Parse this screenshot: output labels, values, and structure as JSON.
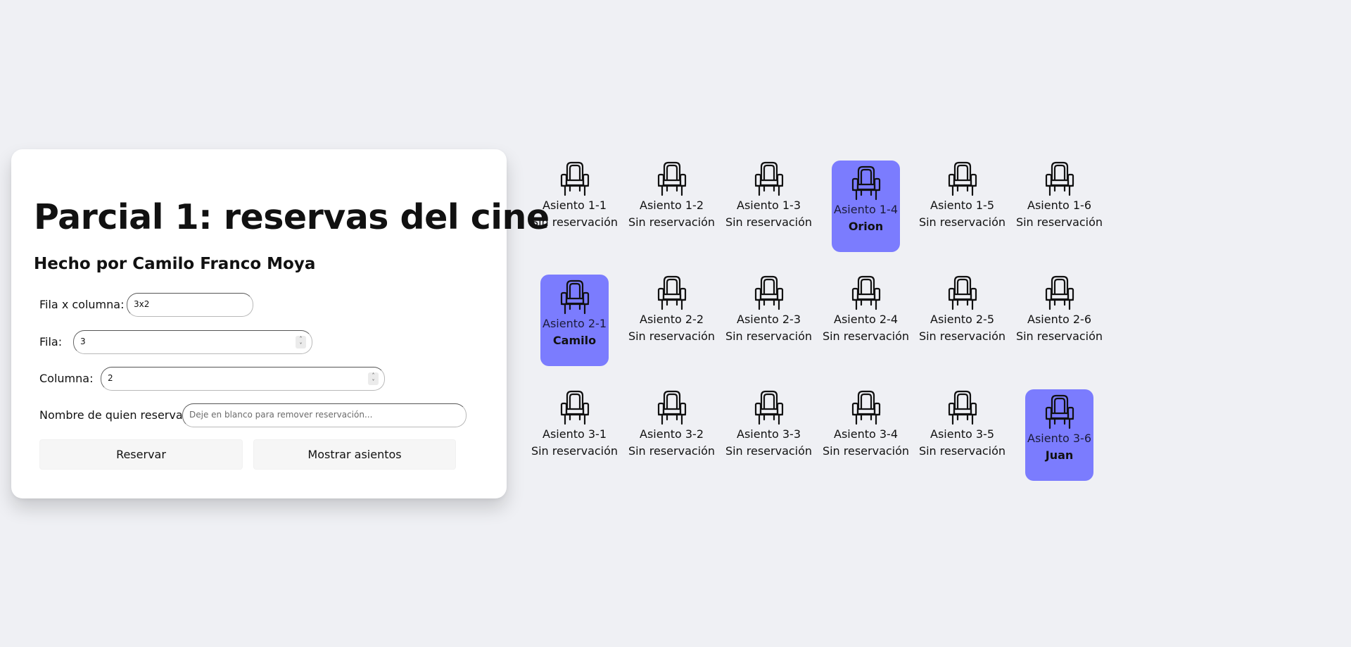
{
  "form": {
    "title": "Parcial 1: reservas del cine",
    "subtitle": "Hecho por Camilo Franco Moya",
    "fila_columna_label": "Fila x columna:",
    "fila_columna_value": "3x2",
    "fila_label": "Fila:",
    "fila_value": "3",
    "columna_label": "Columna:",
    "columna_value": "2",
    "nombre_label": "Nombre de quien reserva:",
    "nombre_placeholder": "Deje en blanco para remover reservación...",
    "reservar_button": "Reservar",
    "mostrar_button": "Mostrar asientos"
  },
  "seats": [
    [
      {
        "label": "Asiento 1-1",
        "status": "Sin reservación",
        "reserved": false
      },
      {
        "label": "Asiento 1-2",
        "status": "Sin reservación",
        "reserved": false
      },
      {
        "label": "Asiento 1-3",
        "status": "Sin reservación",
        "reserved": false
      },
      {
        "label": "Asiento 1-4",
        "status": "Orion",
        "reserved": true
      },
      {
        "label": "Asiento 1-5",
        "status": "Sin reservación",
        "reserved": false
      },
      {
        "label": "Asiento 1-6",
        "status": "Sin reservación",
        "reserved": false
      }
    ],
    [
      {
        "label": "Asiento 2-1",
        "status": "Camilo",
        "reserved": true
      },
      {
        "label": "Asiento 2-2",
        "status": "Sin reservación",
        "reserved": false
      },
      {
        "label": "Asiento 2-3",
        "status": "Sin reservación",
        "reserved": false
      },
      {
        "label": "Asiento 2-4",
        "status": "Sin reservación",
        "reserved": false
      },
      {
        "label": "Asiento 2-5",
        "status": "Sin reservación",
        "reserved": false
      },
      {
        "label": "Asiento 2-6",
        "status": "Sin reservación",
        "reserved": false
      }
    ],
    [
      {
        "label": "Asiento 3-1",
        "status": "Sin reservación",
        "reserved": false
      },
      {
        "label": "Asiento 3-2",
        "status": "Sin reservación",
        "reserved": false
      },
      {
        "label": "Asiento 3-3",
        "status": "Sin reservación",
        "reserved": false
      },
      {
        "label": "Asiento 3-4",
        "status": "Sin reservación",
        "reserved": false
      },
      {
        "label": "Asiento 3-5",
        "status": "Sin reservación",
        "reserved": false
      },
      {
        "label": "Asiento 3-6",
        "status": "Juan",
        "reserved": true
      }
    ]
  ],
  "colors": {
    "background": "#eff0f4",
    "reserved_seat": "#7b7cfe",
    "card": "#ffffff"
  },
  "icons": {
    "seat": "cinema-chair-icon",
    "spinner": "up-down-spinner-icon"
  }
}
